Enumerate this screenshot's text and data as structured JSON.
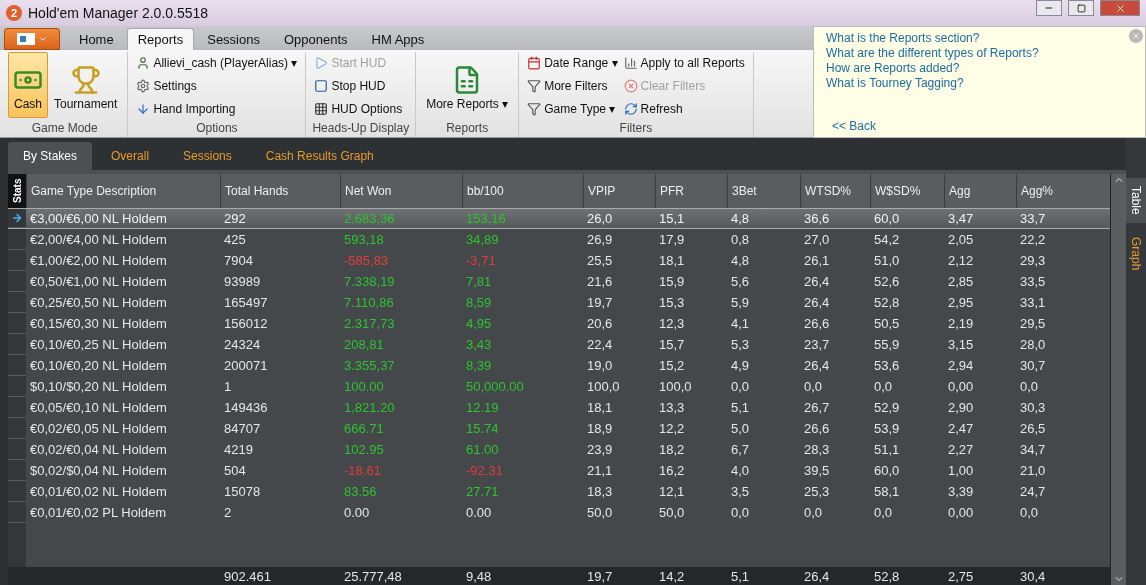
{
  "window": {
    "logo": "2",
    "title": "Hold'em Manager 2.0.0.5518"
  },
  "ribbon_tabs": [
    {
      "label": "Home",
      "selected": false
    },
    {
      "label": "Reports",
      "selected": true
    },
    {
      "label": "Sessions",
      "selected": false
    },
    {
      "label": "Opponents",
      "selected": false
    },
    {
      "label": "HM Apps",
      "selected": false
    }
  ],
  "ribbon_groups": [
    {
      "title": "Game Mode",
      "kind": "large",
      "items": [
        {
          "label": "Cash",
          "selected": true
        },
        {
          "label": "Tournament",
          "selected": false
        }
      ]
    },
    {
      "title": "Options",
      "kind": "small",
      "items": [
        {
          "label": "Allievi_cash (PlayerAlias)",
          "caret": "▾",
          "disabled": false
        },
        {
          "label": "Settings",
          "disabled": false
        },
        {
          "label": "Hand Importing",
          "disabled": false
        }
      ]
    },
    {
      "title": "Heads-Up Display",
      "kind": "small",
      "items": [
        {
          "label": "Start HUD",
          "disabled": true
        },
        {
          "label": "Stop HUD",
          "disabled": false
        },
        {
          "label": "HUD Options",
          "disabled": false
        }
      ]
    },
    {
      "title": "Reports",
      "kind": "menu",
      "items": [
        {
          "label": "More Reports",
          "caret": "▾"
        }
      ]
    },
    {
      "title": "Filters",
      "kind": "small",
      "items": [
        {
          "label": "Date Range",
          "caret": "▾",
          "disabled": false
        },
        {
          "label": "More Filters",
          "disabled": false
        },
        {
          "label": "Game Type",
          "caret": "▾",
          "disabled": false
        },
        {
          "label": "Apply to all Reports",
          "disabled": false
        },
        {
          "label": "Clear Filters",
          "disabled": true
        },
        {
          "label": "Refresh",
          "disabled": false
        }
      ]
    }
  ],
  "help_panel": {
    "links": [
      "What is the Reports section?",
      "What are the different types of Reports?",
      "How are Reports added?",
      "What is Tourney Tagging?"
    ],
    "back": "<< Back"
  },
  "report_tabs": [
    {
      "label": "By Stakes",
      "selected": true
    },
    {
      "label": "Overall",
      "selected": false
    },
    {
      "label": "Sessions",
      "selected": false
    },
    {
      "label": "Cash Results Graph",
      "selected": false
    }
  ],
  "side_tabs": [
    {
      "label": "Table",
      "selected": true
    },
    {
      "label": "Graph",
      "selected": false
    }
  ],
  "table": {
    "stats_label": "Stats",
    "columns": [
      "Game Type Description",
      "Total Hands",
      "Net Won",
      "bb/100",
      "VPIP",
      "PFR",
      "3Bet",
      "WTSD%",
      "W$SD%",
      "Agg",
      "Agg%"
    ],
    "rows": [
      {
        "cells": [
          "€3,00/€6,00 NL Holdem",
          "292",
          "2.683,36",
          "153,16",
          "26,0",
          "15,1",
          "4,8",
          "36,6",
          "60,0",
          "3,47",
          "33,7"
        ],
        "color": "#2ec32e",
        "selected": true
      },
      {
        "cells": [
          "€2,00/€4,00 NL Holdem",
          "425",
          "593,18",
          "34,89",
          "26,9",
          "17,9",
          "0,8",
          "27,0",
          "54,2",
          "2,05",
          "22,2"
        ],
        "color": "#2ec32e",
        "selected": false
      },
      {
        "cells": [
          "€1,00/€2,00 NL Holdem",
          "7904",
          "-585,83",
          "-3,71",
          "25,5",
          "18,1",
          "4,8",
          "26,1",
          "51,0",
          "2,12",
          "29,3"
        ],
        "color": "#e03c3c",
        "selected": false
      },
      {
        "cells": [
          "€0,50/€1,00 NL Holdem",
          "93989",
          "7.338,19",
          "7,81",
          "21,6",
          "15,9",
          "5,6",
          "26,4",
          "52,6",
          "2,85",
          "33,5"
        ],
        "color": "#2ec32e",
        "selected": false
      },
      {
        "cells": [
          "€0,25/€0,50 NL Holdem",
          "165497",
          "7.110,86",
          "8,59",
          "19,7",
          "15,3",
          "5,9",
          "26,4",
          "52,8",
          "2,95",
          "33,1"
        ],
        "color": "#2ec32e",
        "selected": false
      },
      {
        "cells": [
          "€0,15/€0,30 NL Holdem",
          "156012",
          "2.317,73",
          "4,95",
          "20,6",
          "12,3",
          "4,1",
          "26,6",
          "50,5",
          "2,19",
          "29,5"
        ],
        "color": "#2ec32e",
        "selected": false
      },
      {
        "cells": [
          "€0,10/€0,25 NL Holdem",
          "24324",
          "208,81",
          "3,43",
          "22,4",
          "15,7",
          "5,3",
          "23,7",
          "55,9",
          "3,15",
          "28,0"
        ],
        "color": "#2ec32e",
        "selected": false
      },
      {
        "cells": [
          "€0,10/€0,20 NL Holdem",
          "200071",
          "3.355,37",
          "8,39",
          "19,0",
          "15,2",
          "4,9",
          "26,4",
          "53,6",
          "2,94",
          "30,7"
        ],
        "color": "#2ec32e",
        "selected": false
      },
      {
        "cells": [
          "$0,10/$0,20 NL Holdem",
          "1",
          "100.00",
          "50,000.00",
          "100,0",
          "100,0",
          "0,0",
          "0,0",
          "0,0",
          "0,00",
          "0,0"
        ],
        "color": "#2ec32e",
        "selected": false
      },
      {
        "cells": [
          "€0,05/€0,10 NL Holdem",
          "149436",
          "1,821.20",
          "12.19",
          "18,1",
          "13,3",
          "5,1",
          "26,7",
          "52,9",
          "2,90",
          "30,3"
        ],
        "color": "#2ec32e",
        "selected": false
      },
      {
        "cells": [
          "€0,02/€0,05 NL Holdem",
          "84707",
          "666.71",
          "15.74",
          "18,9",
          "12,2",
          "5,0",
          "26,6",
          "53,9",
          "2,47",
          "26,5"
        ],
        "color": "#2ec32e",
        "selected": false
      },
      {
        "cells": [
          "€0,02/€0,04 NL Holdem",
          "4219",
          "102.95",
          "61.00",
          "23,9",
          "18,2",
          "6,7",
          "28,3",
          "51,1",
          "2,27",
          "34,7"
        ],
        "color": "#2ec32e",
        "selected": false
      },
      {
        "cells": [
          "$0,02/$0,04 NL Holdem",
          "504",
          "-18.61",
          "-92.31",
          "21,1",
          "16,2",
          "4,0",
          "39,5",
          "60,0",
          "1,00",
          "21,0"
        ],
        "color": "#e03c3c",
        "selected": false
      },
      {
        "cells": [
          "€0,01/€0,02 NL Holdem",
          "15078",
          "83.56",
          "27.71",
          "18,3",
          "12,1",
          "3,5",
          "25,3",
          "58,1",
          "3,39",
          "24,7"
        ],
        "color": "#2ec32e",
        "selected": false
      },
      {
        "cells": [
          "€0,01/€0,02 PL Holdem",
          "2",
          "0.00",
          "0.00",
          "50,0",
          "50,0",
          "0,0",
          "0,0",
          "0,0",
          "0,00",
          "0,0"
        ],
        "color": "#e6e6e6",
        "selected": false
      }
    ],
    "totals": [
      "902.461",
      "25.777,48",
      "9,48",
      "19,7",
      "14,2",
      "5,1",
      "26,4",
      "52,8",
      "2,75",
      "30,4"
    ]
  }
}
